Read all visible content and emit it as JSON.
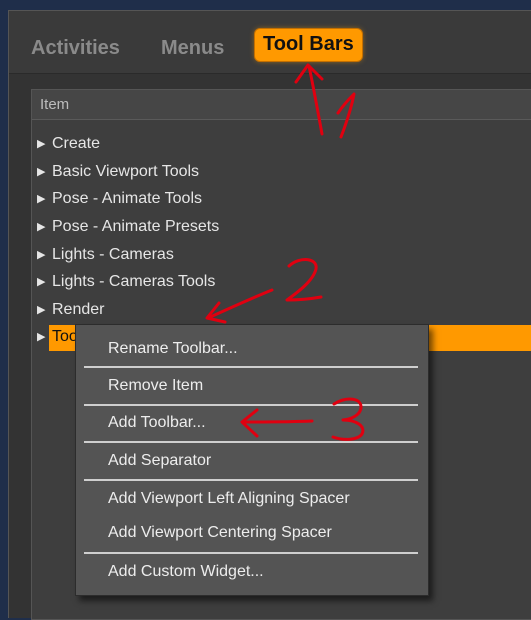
{
  "tabs": [
    "Activities",
    "Menus",
    "Tool Bars"
  ],
  "active_tab": "Tool Bars",
  "list": {
    "column_header": "Item",
    "items": [
      "Create",
      "Basic Viewport Tools",
      "Pose - Animate Tools",
      "Pose - Animate Presets",
      "Lights - Cameras",
      "Lights - Cameras Tools",
      "Render",
      "Too"
    ],
    "selected_index": 7
  },
  "context_menu": {
    "items": [
      "Rename Toolbar...",
      "Remove Item",
      "Add Toolbar...",
      "Add Separator",
      "Add Viewport Left Aligning Spacer",
      "Add Viewport Centering Spacer",
      "Add Custom Widget..."
    ]
  },
  "colors": {
    "accent": "#ff9900",
    "annotation": "#e00010",
    "panel": "#3e3e3e",
    "menu": "#545454"
  },
  "icons": [
    "tree-expand-arrow-icon"
  ]
}
